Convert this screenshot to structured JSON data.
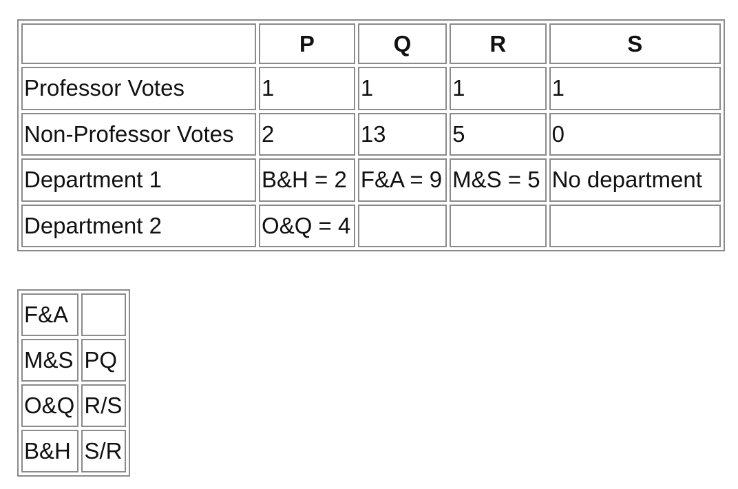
{
  "main_table": {
    "header": [
      "",
      "P",
      "Q",
      "R",
      "S"
    ],
    "rows": [
      [
        "Professor Votes",
        "1",
        "1",
        "1",
        "1"
      ],
      [
        "Non-Professor Votes",
        "2",
        "13",
        "5",
        "0"
      ],
      [
        "Department 1",
        "B&H = 2",
        "F&A = 9",
        "M&S = 5",
        "No department"
      ],
      [
        "Department 2",
        "O&Q = 4",
        "",
        "",
        ""
      ]
    ]
  },
  "legend_table": {
    "rows": [
      [
        "F&A",
        ""
      ],
      [
        "M&S",
        "PQ"
      ],
      [
        "O&Q",
        "R/S"
      ],
      [
        "B&H",
        "S/R"
      ]
    ]
  }
}
